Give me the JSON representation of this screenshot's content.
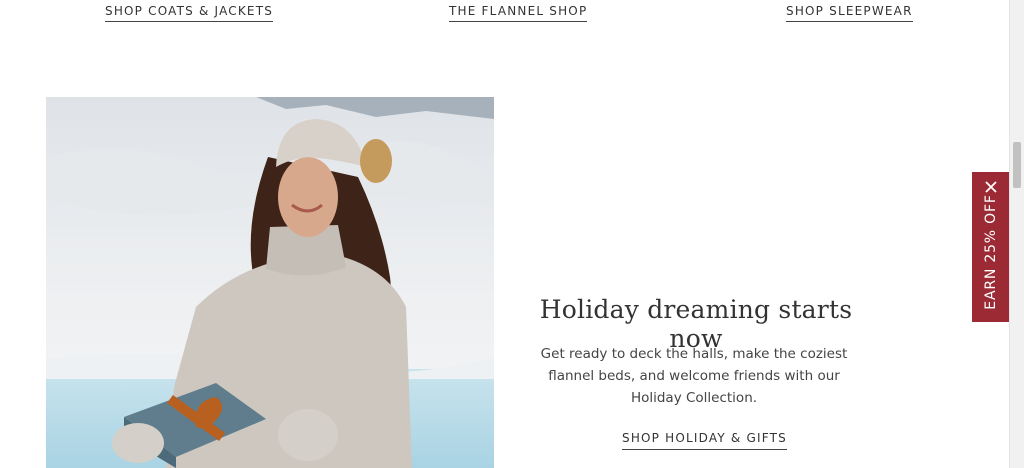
{
  "top_links": [
    {
      "label": "SHOP COATS & JACKETS"
    },
    {
      "label": "THE FLANNEL SHOP"
    },
    {
      "label": "SHOP SLEEPWEAR"
    }
  ],
  "feature": {
    "headline": "Holiday dreaming starts now",
    "body": "Get ready to deck the halls, make the coziest flannel beds, and welcome friends with our Holiday Collection.",
    "cta_label": "SHOP HOLIDAY & GIFTS"
  },
  "promo": {
    "label": "EARN 25% OFF",
    "close_icon": "close-icon",
    "color": "#9b2a35"
  }
}
